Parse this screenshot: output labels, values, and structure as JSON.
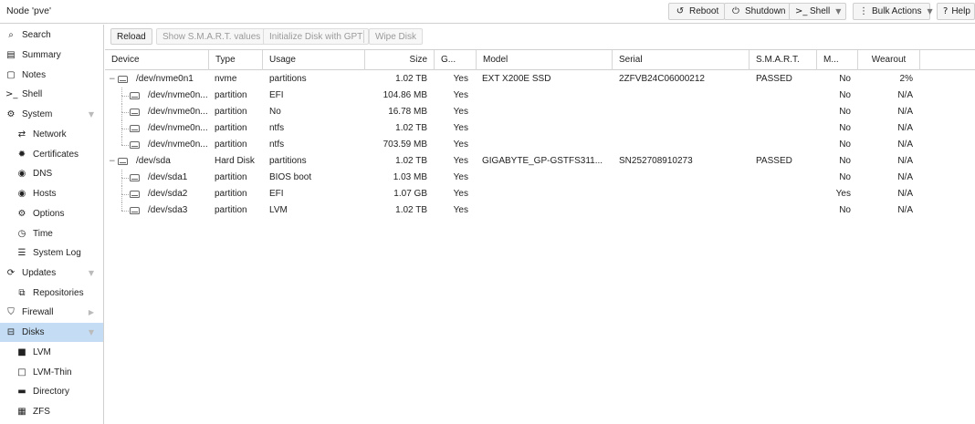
{
  "header": {
    "title": "Node 'pve'",
    "buttons": {
      "reboot": "Reboot",
      "shutdown": "Shutdown",
      "shell": "Shell",
      "bulk": "Bulk Actions",
      "help": "Help"
    }
  },
  "sidebar": {
    "search": "Search",
    "summary": "Summary",
    "notes": "Notes",
    "shell": "Shell",
    "system": "System",
    "network": "Network",
    "certificates": "Certificates",
    "dns": "DNS",
    "hosts": "Hosts",
    "options": "Options",
    "time": "Time",
    "syslog": "System Log",
    "updates": "Updates",
    "repositories": "Repositories",
    "firewall": "Firewall",
    "disks": "Disks",
    "lvm": "LVM",
    "lvmthin": "LVM-Thin",
    "directory": "Directory",
    "zfs": "ZFS"
  },
  "toolbar": {
    "reload": "Reload",
    "smart": "Show S.M.A.R.T. values",
    "init": "Initialize Disk with GPT",
    "wipe": "Wipe Disk"
  },
  "columns": {
    "device": "Device",
    "type": "Type",
    "usage": "Usage",
    "size": "Size",
    "gpt": "G...",
    "model": "Model",
    "serial": "Serial",
    "smart": "S.M.A.R.T.",
    "mounted": "M...",
    "wearout": "Wearout"
  },
  "rows": [
    {
      "device": "/dev/nvme0n1",
      "type": "nvme",
      "usage": "partitions",
      "size": "1.02 TB",
      "gpt": "Yes",
      "model": "EXT X200E SSD",
      "serial": "2ZFVB24C06000212",
      "smart": "PASSED",
      "mounted": "No",
      "wearout": "2%"
    },
    {
      "device": "/dev/nvme0n...",
      "type": "partition",
      "usage": "EFI",
      "size": "104.86 MB",
      "gpt": "Yes",
      "model": "",
      "serial": "",
      "smart": "",
      "mounted": "No",
      "wearout": "N/A"
    },
    {
      "device": "/dev/nvme0n...",
      "type": "partition",
      "usage": "No",
      "size": "16.78 MB",
      "gpt": "Yes",
      "model": "",
      "serial": "",
      "smart": "",
      "mounted": "No",
      "wearout": "N/A"
    },
    {
      "device": "/dev/nvme0n...",
      "type": "partition",
      "usage": "ntfs",
      "size": "1.02 TB",
      "gpt": "Yes",
      "model": "",
      "serial": "",
      "smart": "",
      "mounted": "No",
      "wearout": "N/A"
    },
    {
      "device": "/dev/nvme0n...",
      "type": "partition",
      "usage": "ntfs",
      "size": "703.59 MB",
      "gpt": "Yes",
      "model": "",
      "serial": "",
      "smart": "",
      "mounted": "No",
      "wearout": "N/A"
    },
    {
      "device": "/dev/sda",
      "type": "Hard Disk",
      "usage": "partitions",
      "size": "1.02 TB",
      "gpt": "Yes",
      "model": "GIGABYTE_GP-GSTFS311...",
      "serial": "SN252708910273",
      "smart": "PASSED",
      "mounted": "No",
      "wearout": "N/A"
    },
    {
      "device": "/dev/sda1",
      "type": "partition",
      "usage": "BIOS boot",
      "size": "1.03 MB",
      "gpt": "Yes",
      "model": "",
      "serial": "",
      "smart": "",
      "mounted": "No",
      "wearout": "N/A"
    },
    {
      "device": "/dev/sda2",
      "type": "partition",
      "usage": "EFI",
      "size": "1.07 GB",
      "gpt": "Yes",
      "model": "",
      "serial": "",
      "smart": "",
      "mounted": "Yes",
      "wearout": "N/A"
    },
    {
      "device": "/dev/sda3",
      "type": "partition",
      "usage": "LVM",
      "size": "1.02 TB",
      "gpt": "Yes",
      "model": "",
      "serial": "",
      "smart": "",
      "mounted": "No",
      "wearout": "N/A"
    }
  ]
}
